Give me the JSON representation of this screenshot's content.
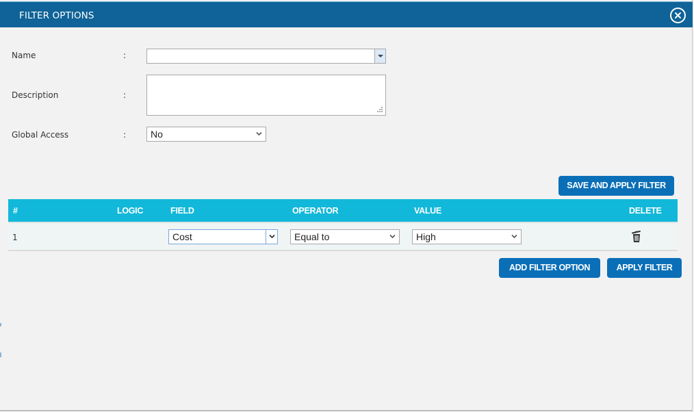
{
  "dialog": {
    "title": "FILTER OPTIONS",
    "close_icon": "close-circle-icon"
  },
  "form": {
    "name": {
      "label": "Name",
      "colon": ":",
      "value": "",
      "placeholder": ""
    },
    "description": {
      "label": "Description",
      "colon": ":",
      "value": ""
    },
    "global_access": {
      "label": "Global Access",
      "colon": ":",
      "selected": "No"
    }
  },
  "buttons": {
    "save_and_apply": "SAVE AND APPLY FILTER",
    "add_filter_option": "ADD FILTER OPTION",
    "apply_filter": "APPLY FILTER"
  },
  "grid": {
    "columns": [
      "#",
      "LOGIC",
      "FIELD",
      "OPERATOR",
      "VALUE",
      "DELETE"
    ],
    "rows": [
      {
        "num": "1",
        "logic": "",
        "field": "Cost",
        "operator": "Equal to",
        "value": "High",
        "delete_icon": "trash-icon"
      }
    ]
  },
  "colors": {
    "header_bg": "#0f6398",
    "grid_header_bg": "#12b8d9",
    "button_bg": "#0b6fb8",
    "page_bg": "#f2f2f2"
  }
}
